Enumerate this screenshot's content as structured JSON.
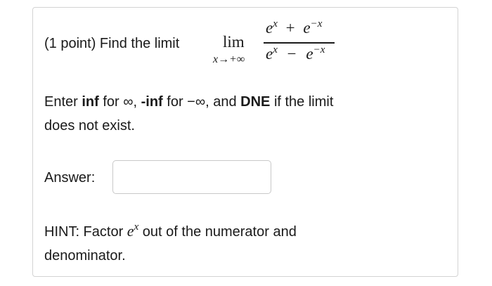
{
  "problem": {
    "intro": "(1 point) Find the limit",
    "limit_word": "lim",
    "limit_subscript": "x→+∞",
    "numerator": {
      "base1": "e",
      "exp1": "x",
      "op": "+",
      "base2": "e",
      "exp2": "−x"
    },
    "denominator": {
      "base1": "e",
      "exp1": "x",
      "op": "−",
      "base2": "e",
      "exp2": "−x"
    }
  },
  "instructions": {
    "part1": "Enter ",
    "inf_keyword": "inf",
    "part2": " for ∞, ",
    "neg_inf_keyword": "-inf",
    "part3": " for −∞, and ",
    "dne_keyword": "DNE",
    "part4": " if the limit",
    "line2": "does not exist."
  },
  "answer": {
    "label": "Answer:",
    "value": "",
    "placeholder": ""
  },
  "hint": {
    "prefix": "HINT: Factor ",
    "math_base": "e",
    "math_exp": "x",
    "suffix": " out of the numerator and",
    "line2": "denominator."
  }
}
